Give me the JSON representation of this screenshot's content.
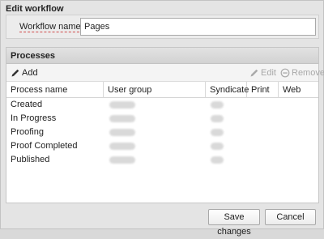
{
  "dialog": {
    "title": "Edit workflow",
    "workflow_name_label": "Workflow name:",
    "workflow_name_value": "Pages"
  },
  "processes": {
    "section_title": "Processes",
    "toolbar": {
      "add_label": "Add",
      "edit_label": "Edit",
      "remove_label": "Remove"
    },
    "columns": [
      "Process name",
      "User group",
      "Syndicate",
      "Print",
      "Web"
    ],
    "rows": [
      {
        "name": "Created"
      },
      {
        "name": "In Progress"
      },
      {
        "name": "Proofing"
      },
      {
        "name": "Proof Completed"
      },
      {
        "name": "Published"
      }
    ]
  },
  "footer": {
    "save_label": "Save changes",
    "cancel_label": "Cancel"
  }
}
